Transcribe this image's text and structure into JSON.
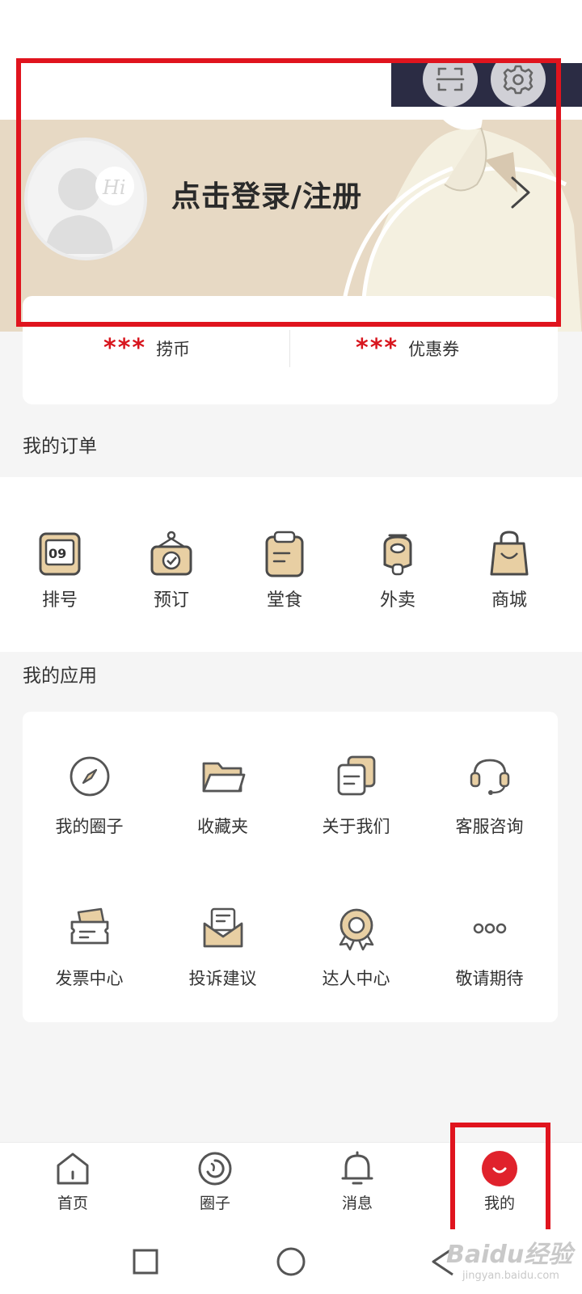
{
  "profile": {
    "login_prompt": "点击登录/注册",
    "avatar_badge": "Hi"
  },
  "top_actions": [
    {
      "icon": "scan-icon"
    },
    {
      "icon": "gear-icon"
    }
  ],
  "stats": [
    {
      "value": "***",
      "label": "捞币"
    },
    {
      "value": "***",
      "label": "优惠券"
    }
  ],
  "orders": {
    "title": "我的订单",
    "items": [
      {
        "label": "排号",
        "icon": "queue-number-icon",
        "badge": "09"
      },
      {
        "label": "预订",
        "icon": "reservation-icon"
      },
      {
        "label": "堂食",
        "icon": "dine-in-clipboard-icon"
      },
      {
        "label": "外卖",
        "icon": "delivery-scooter-icon"
      },
      {
        "label": "商城",
        "icon": "shopping-bag-icon"
      }
    ]
  },
  "apps": {
    "title": "我的应用",
    "items": [
      {
        "label": "我的圈子",
        "icon": "compass-icon"
      },
      {
        "label": "收藏夹",
        "icon": "folder-icon"
      },
      {
        "label": "关于我们",
        "icon": "documents-icon"
      },
      {
        "label": "客服咨询",
        "icon": "headset-icon"
      },
      {
        "label": "发票中心",
        "icon": "invoice-card-icon"
      },
      {
        "label": "投诉建议",
        "icon": "mail-envelope-icon"
      },
      {
        "label": "达人中心",
        "icon": "award-medal-icon"
      },
      {
        "label": "敬请期待",
        "icon": "more-dots-icon"
      }
    ]
  },
  "tabbar": [
    {
      "label": "首页",
      "icon": "home-icon"
    },
    {
      "label": "圈子",
      "icon": "circle-swirl-icon"
    },
    {
      "label": "消息",
      "icon": "bell-icon"
    },
    {
      "label": "我的",
      "icon": "profile-face-icon",
      "active": true
    }
  ],
  "watermark": {
    "main": "Baidu经验",
    "sub": "jingyan.baidu.com"
  },
  "colors": {
    "accent_red": "#d8161e",
    "annotation_red": "#e0141e",
    "icon_tan": "#e8cfa3",
    "icon_outline": "#4a4a4a",
    "banner_bg": "#e7d9c4"
  }
}
